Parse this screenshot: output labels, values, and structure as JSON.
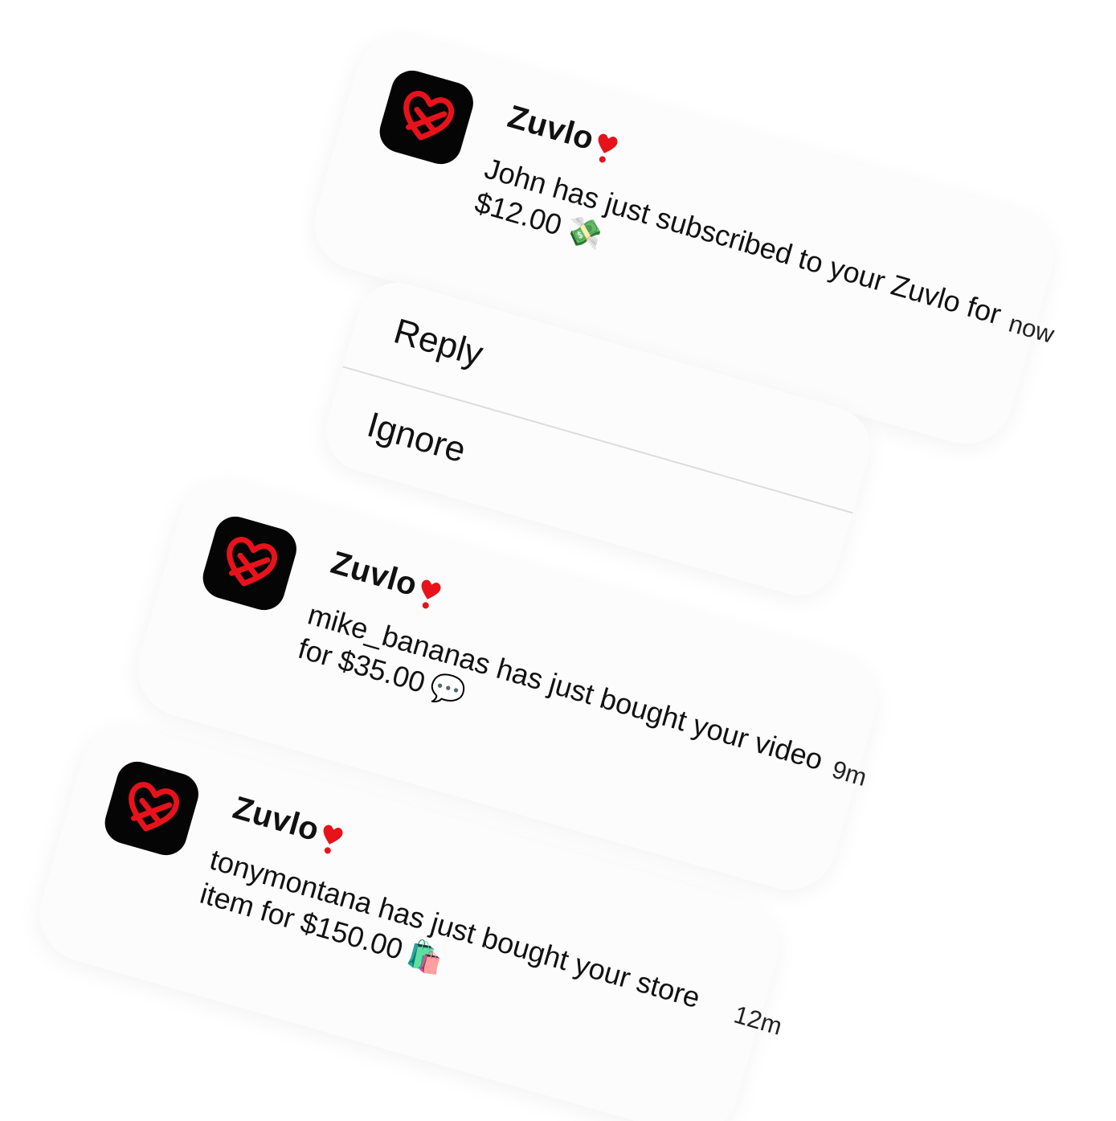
{
  "notifications": [
    {
      "app_name": "Zuvlo",
      "title_emoji": "❣️",
      "message": "John has just subscribed to your Zuvlo for $12.00",
      "message_emoji": "💸",
      "time": "now",
      "icon": "zuvlo-app-icon"
    },
    {
      "app_name": "Zuvlo",
      "title_emoji": "❣️",
      "message": "mike_bananas has just bought your video for $35.00",
      "message_emoji": "💬",
      "time": "9m",
      "icon": "zuvlo-app-icon"
    },
    {
      "app_name": "Zuvlo",
      "title_emoji": "❣️",
      "message": "tonymontana has just bought your store item for $150.00",
      "message_emoji": "🛍️",
      "time": "12m",
      "icon": "zuvlo-app-icon"
    }
  ],
  "actions": {
    "reply": "Reply",
    "ignore": "Ignore"
  },
  "colors": {
    "brand_red": "#e8121b",
    "icon_bg": "#050505"
  }
}
